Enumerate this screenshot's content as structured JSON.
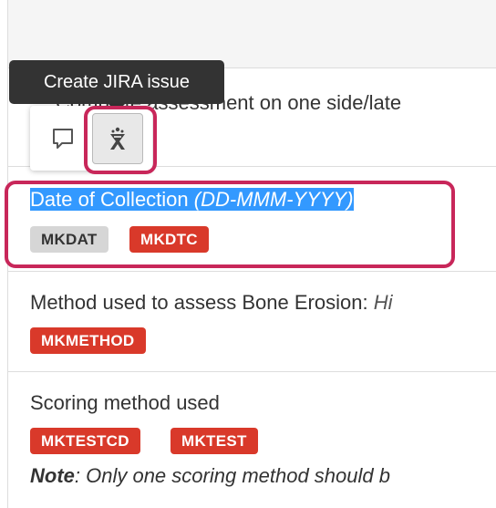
{
  "tooltip": {
    "text": "Create JIRA issue"
  },
  "toolbar": {
    "comment_icon": "speech-bubble-icon",
    "jira_icon": "jira-ghost-icon"
  },
  "rows": [
    {
      "text": "Complete assessment on one side/late",
      "badges": []
    },
    {
      "text": "Date of Collection",
      "italic": "(DD-MMM-YYYY)",
      "selected": true,
      "badges": [
        {
          "label": "MKDAT",
          "style": "gray"
        },
        {
          "label": "MKDTC",
          "style": "red"
        }
      ]
    },
    {
      "text": "Method used to assess Bone Erosion:",
      "italic": "Hi",
      "badges": [
        {
          "label": "MKMETHOD",
          "style": "red"
        }
      ]
    },
    {
      "text": "Scoring method used",
      "badges": [
        {
          "label": "MKTESTCD",
          "style": "red"
        },
        {
          "label": "MKTEST",
          "style": "red"
        }
      ],
      "note_label": "Note",
      "note_text": ": Only one scoring method should b"
    }
  ],
  "colors": {
    "badge_red": "#d9392a",
    "badge_gray": "#d6d6d6",
    "highlight": "#c8275a",
    "selection": "#3399ff"
  }
}
